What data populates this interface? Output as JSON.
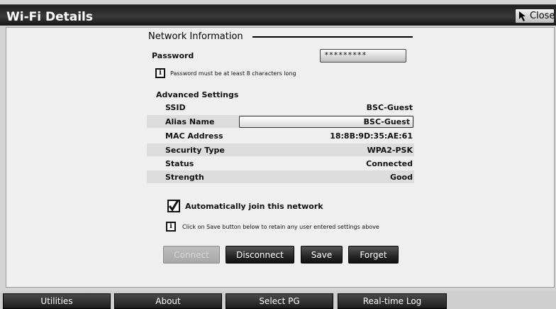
{
  "window": {
    "title": "Wi-Fi Details",
    "close_label": "Close"
  },
  "network": {
    "section_title": "Network Information",
    "password_label": "Password",
    "password_value": "*********",
    "password_hint": "Password must be at least 8 characters long",
    "advanced_title": "Advanced Settings",
    "rows": [
      {
        "label": "SSID",
        "value": "BSC-Guest"
      },
      {
        "label": "Alias Name",
        "value": "BSC-Guest"
      },
      {
        "label": "MAC Address",
        "value": "18:8B:9D:35:AE:61"
      },
      {
        "label": "Security Type",
        "value": "WPA2-PSK"
      },
      {
        "label": "Status",
        "value": "Connected"
      },
      {
        "label": "Strength",
        "value": "Good"
      }
    ],
    "auto_join_label": "Automatically join this network",
    "auto_join_checked": true,
    "save_hint": "Click on Save button below to retain any user entered settings above"
  },
  "buttons": {
    "connect": "Connect",
    "disconnect": "Disconnect",
    "save": "Save",
    "forget": "Forget"
  },
  "taskbar": {
    "tabs": [
      "Utilities",
      "About",
      "Select PG",
      "Real-time Log"
    ]
  },
  "icons": {
    "info": "info-icon",
    "close": "cursor-arrow-icon",
    "check": "checkmark-icon"
  }
}
